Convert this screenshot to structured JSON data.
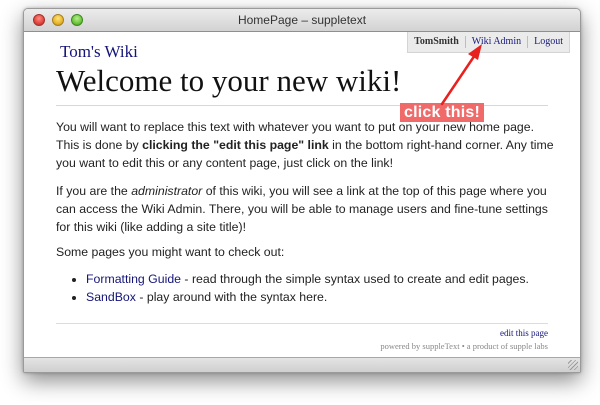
{
  "window": {
    "title": "HomePage – suppletext"
  },
  "userbar": {
    "username": "TomSmith",
    "admin_link": "Wiki Admin",
    "logout_link": "Logout"
  },
  "page": {
    "site_title": "Tom's Wiki",
    "heading": "Welcome to your new wiki!",
    "p1": {
      "a": "You will want to replace this text with whatever you want to put on your new home page. This is done by ",
      "b": "clicking the \"edit this page\" link",
      "c": " in the bottom right-hand corner. Any time you want to edit this or any content page, just click on the link!"
    },
    "p2": {
      "a": "If you are the ",
      "b": "administrator",
      "c": " of this wiki, you will see a link at the top of this page where you can access the Wiki Admin. There, you will be able to manage users and fine-tune settings for this wiki (like adding a site title)!"
    },
    "p3": "Some pages you might want to check out:",
    "pages": [
      {
        "link": "Formatting Guide",
        "desc": " - read through the simple syntax used to create and edit pages."
      },
      {
        "link": "SandBox",
        "desc": " - play around with the syntax here."
      }
    ],
    "edit_link": "edit this page",
    "footer": "powered by suppleText • a product of supple labs"
  },
  "annotation": {
    "text": "click this!",
    "color": "#f06a6a",
    "arrow_color": "#e8211e"
  }
}
